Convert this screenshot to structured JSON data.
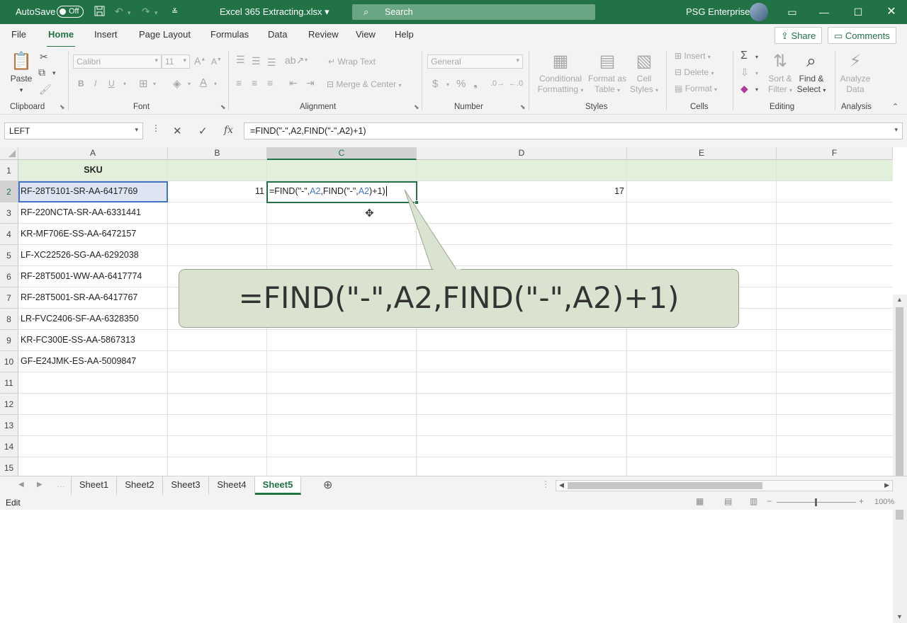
{
  "titlebar": {
    "autosave_label": "AutoSave",
    "autosave_state": "Off",
    "filename": "Excel 365 Extracting.xlsx",
    "search_placeholder": "Search",
    "account_name": "PSG Enterprises"
  },
  "tabs": [
    "File",
    "Home",
    "Insert",
    "Page Layout",
    "Formulas",
    "Data",
    "Review",
    "View",
    "Help"
  ],
  "active_tab": "Home",
  "share_label": "Share",
  "comments_label": "Comments",
  "ribbon": {
    "clipboard": {
      "paste": "Paste",
      "name": "Clipboard"
    },
    "font": {
      "face": "Calibri",
      "size": "11",
      "name": "Font"
    },
    "alignment": {
      "wrap": "Wrap Text",
      "merge": "Merge & Center",
      "name": "Alignment"
    },
    "number": {
      "format": "General",
      "name": "Number"
    },
    "styles": {
      "conditional": [
        "Conditional",
        "Formatting"
      ],
      "format_as": [
        "Format as",
        "Table"
      ],
      "cell_styles": [
        "Cell",
        "Styles"
      ],
      "name": "Styles"
    },
    "cells": {
      "insert": "Insert",
      "delete": "Delete",
      "format": "Format",
      "name": "Cells"
    },
    "editing": {
      "sort": [
        "Sort &",
        "Filter"
      ],
      "find": [
        "Find &",
        "Select"
      ],
      "name": "Editing"
    },
    "analysis": {
      "analyze": [
        "Analyze",
        "Data"
      ],
      "name": "Analysis"
    }
  },
  "name_box": "LEFT",
  "formula_bar": "=FIND(\"-\",A2,FIND(\"-\",A2)+1)",
  "columns": [
    "A",
    "B",
    "C",
    "D",
    "E",
    "F"
  ],
  "rows": [
    "1",
    "2",
    "3",
    "4",
    "5",
    "6",
    "7",
    "8",
    "9",
    "10",
    "11",
    "12",
    "13",
    "14",
    "15"
  ],
  "cells": {
    "A1": "SKU",
    "A2": "RF-28T5101-SR-AA-6417769",
    "A3": "RF-220NCTA-SR-AA-6331441",
    "A4": "KR-MF706E-SS-AA-6472157",
    "A5": "LF-XC22526-SG-AA-6292038",
    "A6": "RF-28T5001-WW-AA-6417774",
    "A7": "RF-28T5001-SR-AA-6417767",
    "A8": "LR-FVC2406-SF-AA-6328350",
    "A9": "KR-FC300E-SS-AA-5867313",
    "A10": "GF-E24JMK-ES-AA-5009847",
    "B2": "11",
    "D2": "17"
  },
  "edit_cell": {
    "p1": "=FIND(\"-\",",
    "r1": "A2",
    "p2": ",FIND(\"-\",",
    "r2": "A2",
    "p3": ")+1)"
  },
  "callout_text": "=FIND(\"-\",A2,FIND(\"-\",A2)+1)",
  "sheets": [
    "Sheet1",
    "Sheet2",
    "Sheet3",
    "Sheet4",
    "Sheet5"
  ],
  "active_sheet": "Sheet5",
  "status": {
    "mode": "Edit",
    "zoom": "100%"
  },
  "colors": {
    "brand": "#217346",
    "ref_blue": "#4472c4",
    "callout_fill": "#d9e3cf",
    "header_row_fill": "#e2efda"
  }
}
